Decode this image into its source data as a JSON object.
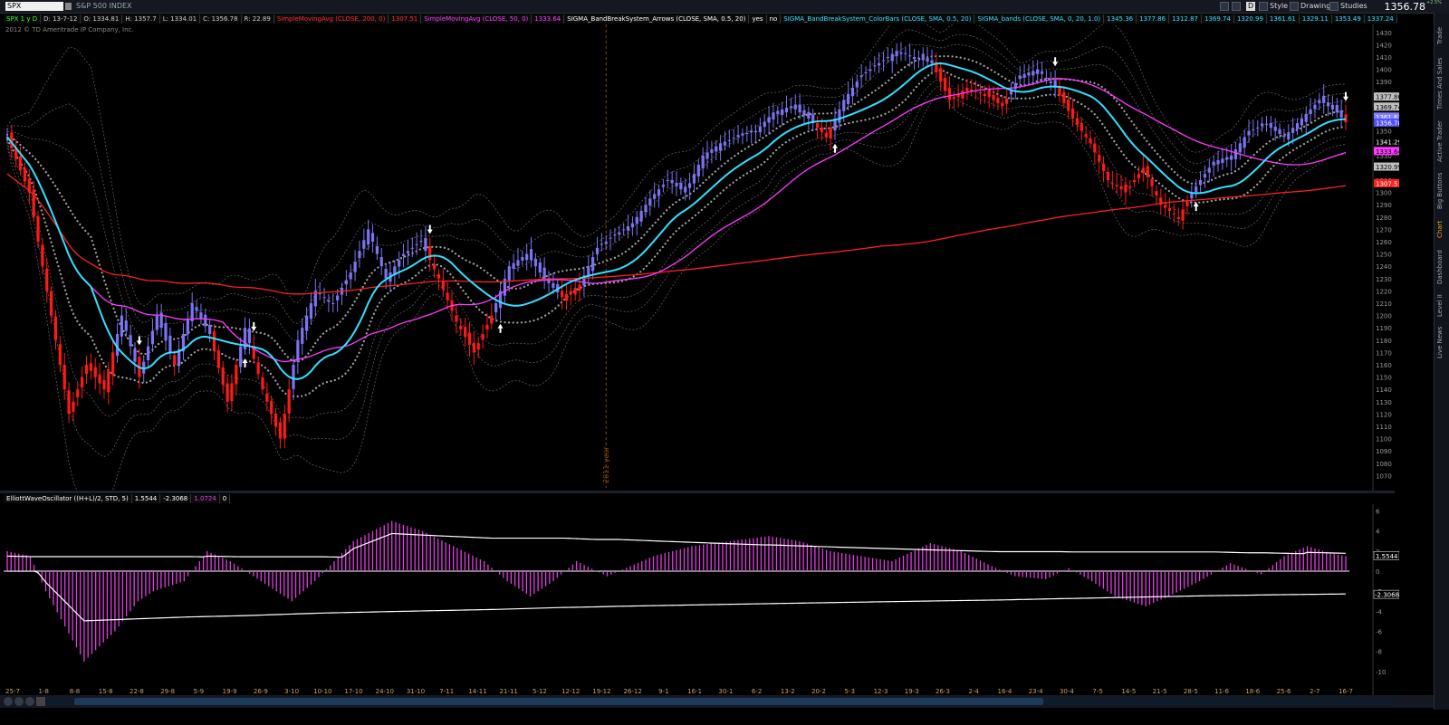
{
  "toolbar": {
    "symbol": "SPX",
    "symbol_name": "S&P 500 INDEX",
    "style_label": "Style",
    "drawings_label": "Drawings",
    "studies_label": "Studies",
    "last_price": "1356.78",
    "change_label": "+2.5%",
    "period_button": "D"
  },
  "study_bar": {
    "ohlc": [
      "SPX 1 y D",
      "D: 13-7-12",
      "O: 1334.81",
      "H: 1357.7",
      "L: 1334.01",
      "C: 1356.78",
      "R: 22.89"
    ],
    "studies": [
      {
        "label": "SimpleMovingAvg (CLOSE, 200, 0)",
        "value": "1307.51",
        "color": "#ff2a2a"
      },
      {
        "label": "SimpleMovingAvg (CLOSE, 50, 0)",
        "value": "1333.64",
        "color": "#ff3cff"
      },
      {
        "label": "SIGMA_BandBreakSystem_Arrows (CLOSE, SMA, 0.5, 20)",
        "value": "yes",
        "value2": "no",
        "color": "#ffffff"
      },
      {
        "label": "SIGMA_BandBreakSystem_ColorBars (CLOSE, SMA, 0.5, 20)",
        "value": "",
        "color": "#33e0ff"
      },
      {
        "label": "SIGMA_bands (CLOSE, SMA, 0, 20, 1.0)",
        "values": [
          "1345.36",
          "1377.86",
          "1312.87",
          "1369.74",
          "1320.99",
          "1361.61",
          "1329.11",
          "1353.49",
          "1337.24"
        ],
        "color": "#33e0ff"
      }
    ]
  },
  "copyright": "2012 © TD Ameritrade IP Company, Inc.",
  "right_rail_tabs": [
    "Trade",
    "Times And Sales",
    "Active Trader",
    "Big Buttons",
    "Chart",
    "Dashboard",
    "Level II",
    "Live News"
  ],
  "right_rail_active": "Chart",
  "chart_data": [
    {
      "type": "bar",
      "title": "",
      "ylim": [
        1060,
        1435
      ],
      "yticks": [
        1430,
        1420,
        1410,
        1400,
        1390,
        1380,
        1370,
        1360,
        1350,
        1340,
        1330,
        1320,
        1310,
        1300,
        1290,
        1280,
        1270,
        1260,
        1250,
        1240,
        1230,
        1220,
        1210,
        1200,
        1190,
        1180,
        1170,
        1160,
        1150,
        1140,
        1130,
        1120,
        1110,
        1100,
        1090,
        1080,
        1070
      ],
      "xticks": [
        "25-7",
        "1-8",
        "8-8",
        "15-8",
        "22-8",
        "29-8",
        "5-9",
        "19-9",
        "26-9",
        "3-10",
        "10-10",
        "17-10",
        "24-10",
        "31-10",
        "7-11",
        "14-11",
        "21-11",
        "5-12",
        "12-12",
        "19-12",
        "26-12",
        "9-1",
        "16-1",
        "30-1",
        "6-2",
        "13-2",
        "20-2",
        "5-3",
        "12-3",
        "19-3",
        "26-3",
        "2-4",
        "16-4",
        "23-4",
        "30-4",
        "7-5",
        "14-5",
        "21-5",
        "28-5",
        "11-6",
        "18-6",
        "25-6",
        "2-7",
        "16-7"
      ],
      "year_marker": "2011 year",
      "close_anchors": [
        [
          0,
          1345
        ],
        [
          5,
          1300
        ],
        [
          10,
          1200
        ],
        [
          14,
          1120
        ],
        [
          18,
          1160
        ],
        [
          22,
          1140
        ],
        [
          26,
          1200
        ],
        [
          30,
          1150
        ],
        [
          34,
          1200
        ],
        [
          38,
          1160
        ],
        [
          42,
          1210
        ],
        [
          46,
          1185
        ],
        [
          50,
          1130
        ],
        [
          54,
          1190
        ],
        [
          58,
          1140
        ],
        [
          62,
          1100
        ],
        [
          66,
          1180
        ],
        [
          70,
          1220
        ],
        [
          74,
          1210
        ],
        [
          78,
          1235
        ],
        [
          82,
          1270
        ],
        [
          86,
          1230
        ],
        [
          90,
          1250
        ],
        [
          94,
          1260
        ],
        [
          98,
          1230
        ],
        [
          102,
          1195
        ],
        [
          106,
          1170
        ],
        [
          110,
          1200
        ],
        [
          114,
          1240
        ],
        [
          118,
          1250
        ],
        [
          122,
          1230
        ],
        [
          126,
          1215
        ],
        [
          130,
          1225
        ],
        [
          134,
          1255
        ],
        [
          138,
          1265
        ],
        [
          142,
          1275
        ],
        [
          146,
          1295
        ],
        [
          150,
          1310
        ],
        [
          154,
          1300
        ],
        [
          158,
          1330
        ],
        [
          162,
          1340
        ],
        [
          166,
          1345
        ],
        [
          170,
          1350
        ],
        [
          174,
          1365
        ],
        [
          178,
          1370
        ],
        [
          182,
          1360
        ],
        [
          186,
          1345
        ],
        [
          190,
          1375
        ],
        [
          194,
          1395
        ],
        [
          198,
          1405
        ],
        [
          202,
          1415
        ],
        [
          206,
          1410
        ],
        [
          210,
          1405
        ],
        [
          214,
          1375
        ],
        [
          218,
          1385
        ],
        [
          222,
          1380
        ],
        [
          226,
          1370
        ],
        [
          230,
          1395
        ],
        [
          234,
          1400
        ],
        [
          238,
          1385
        ],
        [
          242,
          1360
        ],
        [
          246,
          1340
        ],
        [
          250,
          1310
        ],
        [
          254,
          1300
        ],
        [
          258,
          1320
        ],
        [
          262,
          1290
        ],
        [
          266,
          1280
        ],
        [
          270,
          1305
        ],
        [
          274,
          1325
        ],
        [
          278,
          1330
        ],
        [
          282,
          1350
        ],
        [
          286,
          1355
        ],
        [
          290,
          1345
        ],
        [
          294,
          1360
        ],
        [
          298,
          1375
        ],
        [
          302,
          1365
        ],
        [
          304,
          1357
        ]
      ],
      "colors": {
        "up": "#7b74f0",
        "down": "#ff1a1a",
        "sma200": "#ff2020",
        "sma50": "#ff3cff",
        "mid_band": "#33e0ff",
        "band_dots": "#a0a0a0",
        "dashed_bands": "#6a6a6a"
      },
      "price_labels": [
        {
          "text": "1377.86",
          "value": 1377.86,
          "bg": "#c0c0c0",
          "fg": "#000"
        },
        {
          "text": "1369.74",
          "value": 1369.74,
          "bg": "#c0c0c0",
          "fg": "#000"
        },
        {
          "text": "1361.61",
          "value": 1361.61,
          "bg": "#8080ff",
          "fg": "#fff"
        },
        {
          "text": "1356.78",
          "value": 1356.78,
          "bg": "#5050ff",
          "fg": "#fff"
        },
        {
          "text": "1341.29",
          "value": 1341.29,
          "bg": "#000",
          "fg": "#fff"
        },
        {
          "text": "1333.64",
          "value": 1333.64,
          "bg": "#ff3cff",
          "fg": "#000"
        },
        {
          "text": "1320.99",
          "value": 1320.99,
          "bg": "#c0c0c0",
          "fg": "#000"
        },
        {
          "text": "1307.51",
          "value": 1307.51,
          "bg": "#ff2020",
          "fg": "#fff"
        }
      ]
    },
    {
      "type": "bar",
      "title": "ElliottWaveOscillator ((H+L)/2, STD, 5)",
      "header_values": [
        "1.5544",
        "-2.3068",
        "1.0724",
        "0"
      ],
      "ylim": [
        -11,
        6.5
      ],
      "yticks": [
        6,
        4,
        2,
        0,
        -2,
        -4,
        -6,
        -8,
        -10
      ],
      "upper_line_value": "1.5544",
      "lower_line_value": "-2.3068",
      "hist_anchors": [
        [
          0,
          2
        ],
        [
          6,
          1.5
        ],
        [
          10,
          -2
        ],
        [
          20,
          -9
        ],
        [
          28,
          -6
        ],
        [
          34,
          -3
        ],
        [
          38,
          -2
        ],
        [
          46,
          -1
        ],
        [
          52,
          2
        ],
        [
          58,
          1
        ],
        [
          66,
          -1
        ],
        [
          74,
          -3
        ],
        [
          80,
          -1
        ],
        [
          90,
          3
        ],
        [
          100,
          5
        ],
        [
          108,
          4
        ],
        [
          116,
          2.5
        ],
        [
          124,
          1
        ],
        [
          130,
          -1
        ],
        [
          136,
          -2.5
        ],
        [
          142,
          -1
        ],
        [
          148,
          1
        ],
        [
          156,
          -0.5
        ],
        [
          162,
          0.5
        ],
        [
          168,
          1.5
        ],
        [
          178,
          2.5
        ],
        [
          188,
          3
        ],
        [
          198,
          3.5
        ],
        [
          206,
          3
        ],
        [
          214,
          2
        ],
        [
          222,
          1.5
        ],
        [
          230,
          1
        ],
        [
          240,
          2.8
        ],
        [
          248,
          2
        ],
        [
          256,
          0.5
        ],
        [
          262,
          -0.5
        ],
        [
          270,
          -0.8
        ],
        [
          276,
          0.3
        ],
        [
          282,
          -1
        ],
        [
          288,
          -2.5
        ],
        [
          296,
          -3.5
        ],
        [
          302,
          -2.5
        ],
        [
          310,
          -1
        ],
        [
          318,
          0.8
        ],
        [
          326,
          -0.3
        ],
        [
          332,
          1.5
        ],
        [
          338,
          2.5
        ],
        [
          344,
          1.8
        ],
        [
          348,
          1.5
        ]
      ],
      "hist_color": "#e040e0",
      "line_color": "#ffffff"
    }
  ]
}
